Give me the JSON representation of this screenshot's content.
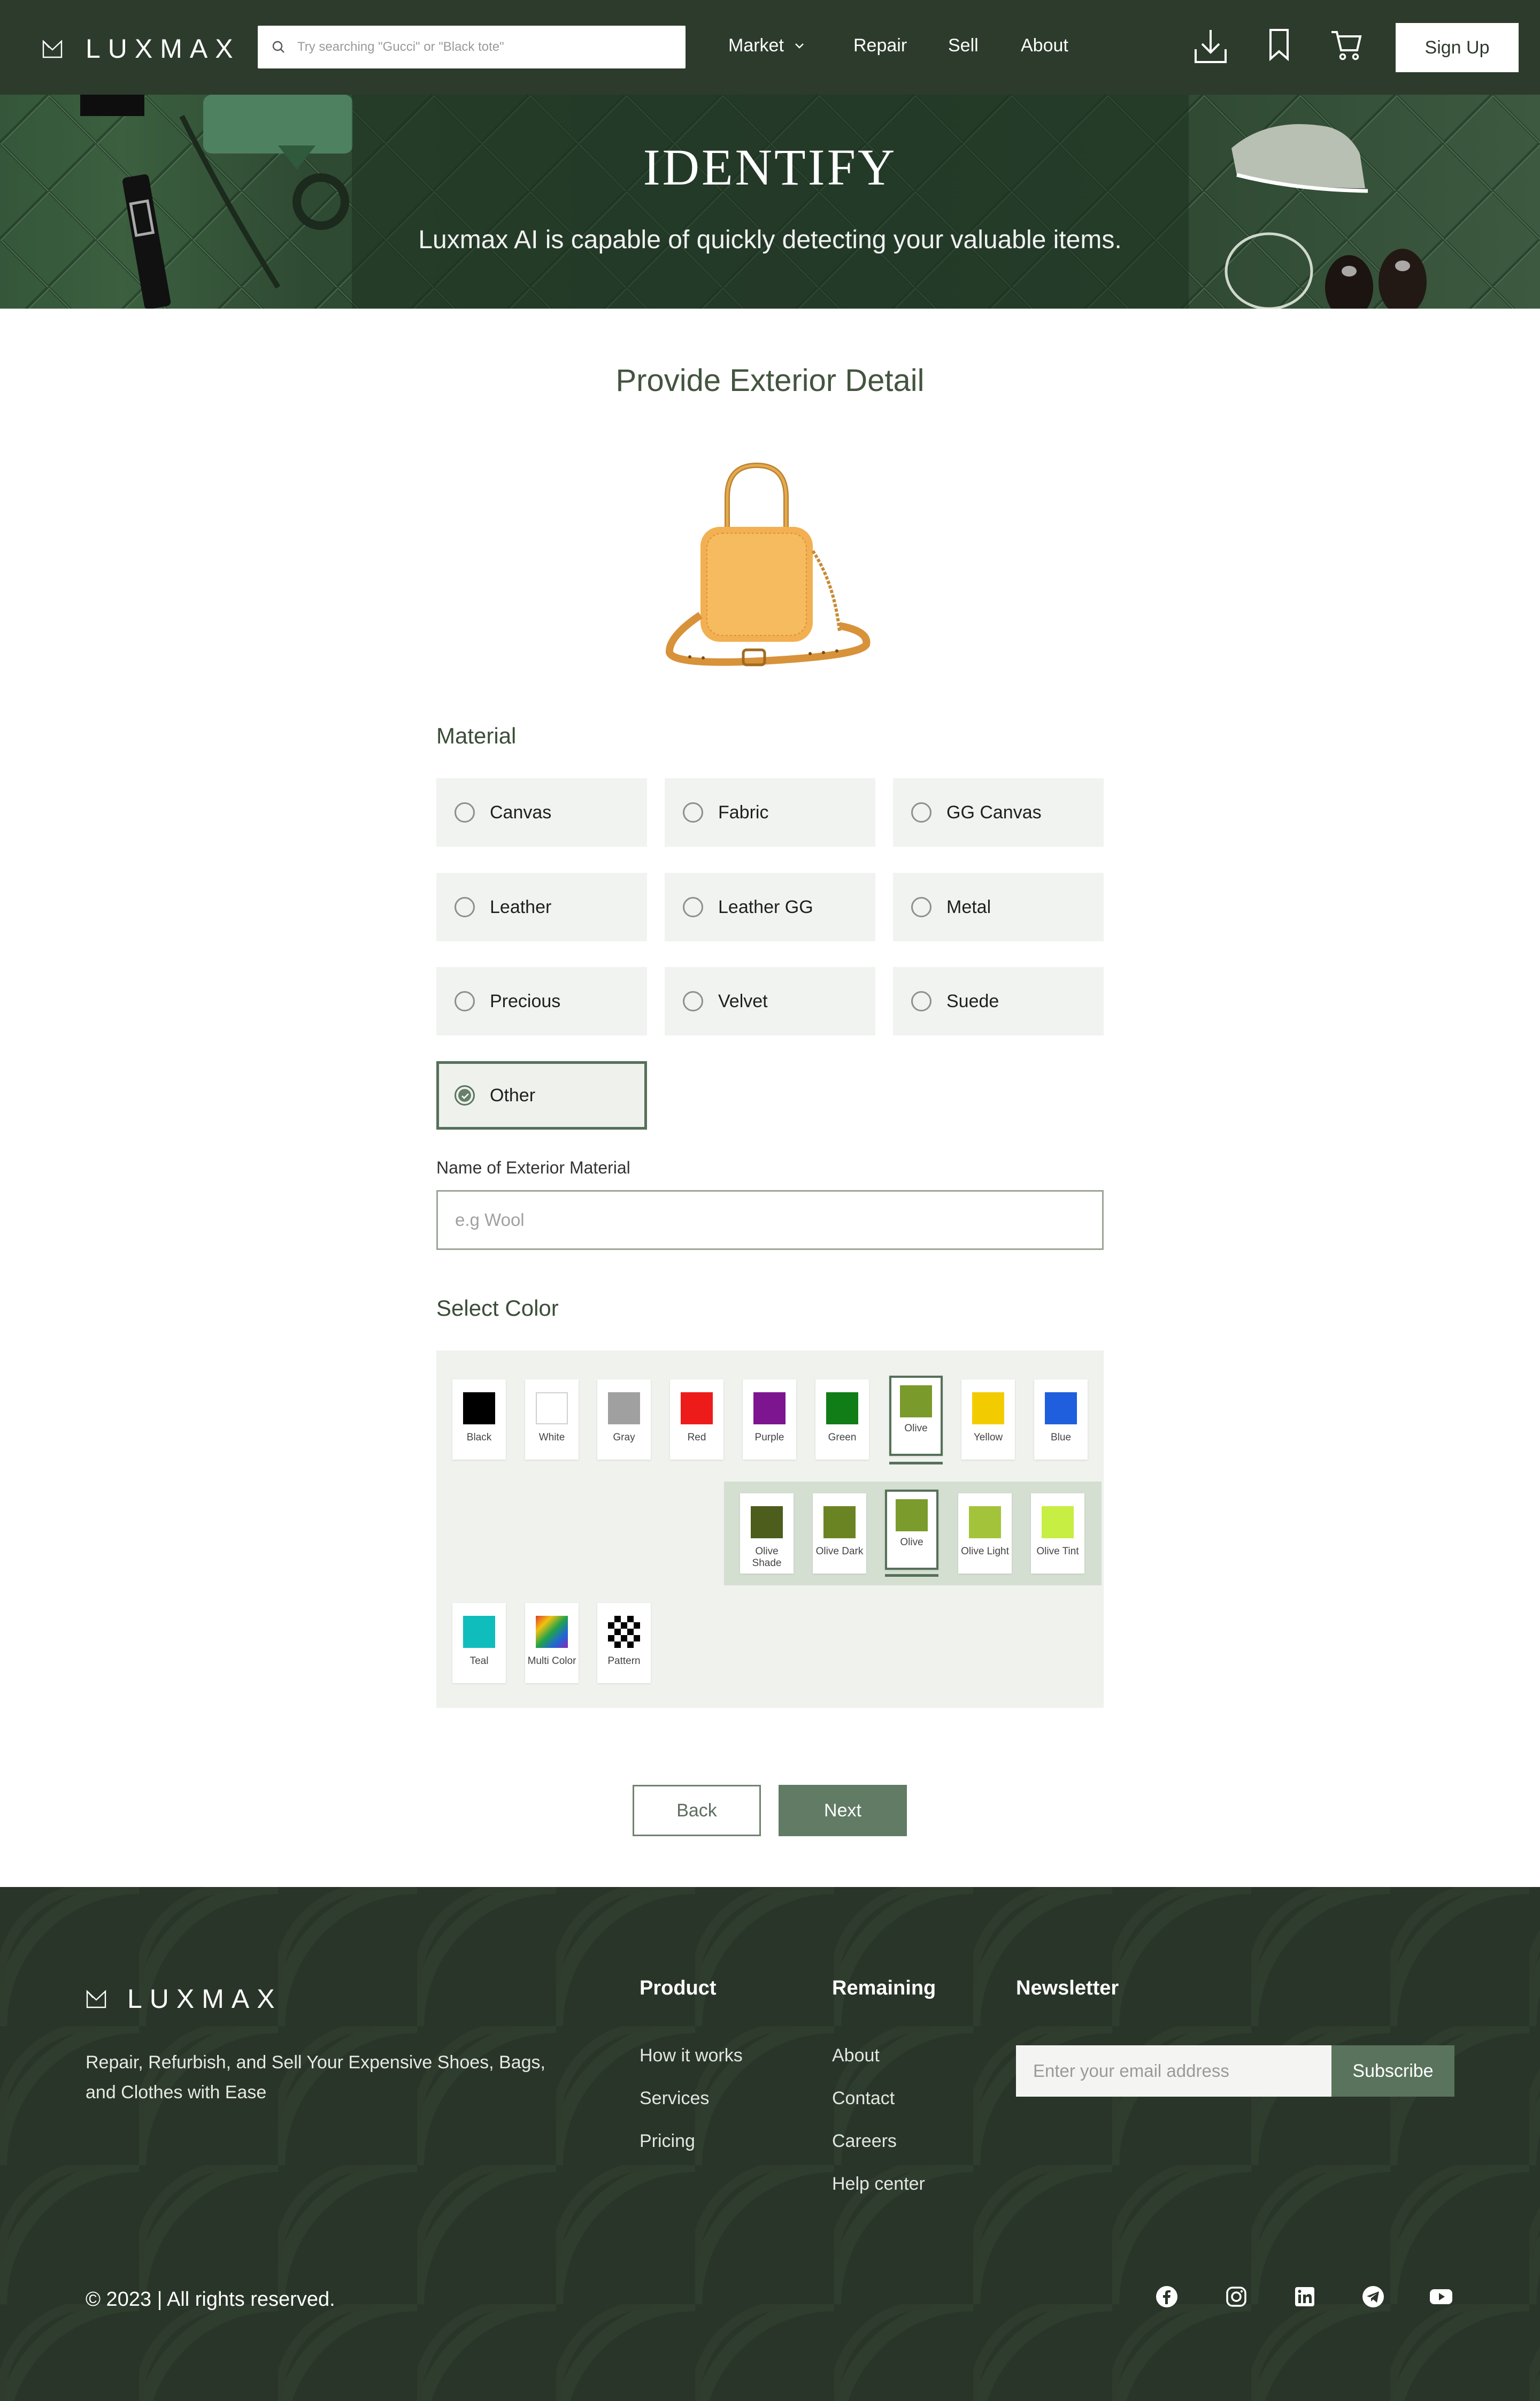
{
  "nav": {
    "brand": "LUXMAX",
    "search_placeholder": "Try searching \"Gucci\" or \"Black tote\"",
    "links": [
      "Market",
      "Repair",
      "Sell",
      "About"
    ],
    "icons": [
      "download-icon",
      "bookmark-icon",
      "cart-icon"
    ],
    "signup_label": "Sign Up"
  },
  "hero": {
    "title": "IDENTIFY",
    "subtitle": "Luxmax AI is capable of quickly detecting your valuable items."
  },
  "main": {
    "title": "Provide Exterior Detail",
    "material_label": "Material",
    "materials": [
      {
        "label": "Canvas",
        "selected": false
      },
      {
        "label": "Fabric",
        "selected": false
      },
      {
        "label": "GG Canvas",
        "selected": false
      },
      {
        "label": "Leather",
        "selected": false
      },
      {
        "label": "Leather GG",
        "selected": false
      },
      {
        "label": "Metal",
        "selected": false
      },
      {
        "label": "Precious",
        "selected": false
      },
      {
        "label": "Velvet",
        "selected": false
      },
      {
        "label": "Suede",
        "selected": false
      },
      {
        "label": "Other",
        "selected": true
      }
    ],
    "exterior_name_label": "Name of Exterior Material",
    "exterior_name_placeholder": "e.g Wool",
    "exterior_name_value": "",
    "color_label": "Select Color",
    "colors": [
      {
        "label": "Black",
        "hex": "#000000"
      },
      {
        "label": "White",
        "hex": "#ffffff"
      },
      {
        "label": "Gray",
        "hex": "#a0a0a0"
      },
      {
        "label": "Red",
        "hex": "#ee1b1b"
      },
      {
        "label": "Purple",
        "hex": "#7d1590"
      },
      {
        "label": "Green",
        "hex": "#117d17"
      },
      {
        "label": "Olive",
        "hex": "#7a9a2b",
        "selected": true
      },
      {
        "label": "Yellow",
        "hex": "#f2cc00"
      },
      {
        "label": "Blue",
        "hex": "#1f5fdd"
      }
    ],
    "olive_shades": [
      {
        "label": "Olive Shade",
        "hex": "#4c5d1c"
      },
      {
        "label": "Olive Dark",
        "hex": "#6b8423"
      },
      {
        "label": "Olive",
        "hex": "#7b9b2c",
        "selected": true
      },
      {
        "label": "Olive Light",
        "hex": "#a3c43a"
      },
      {
        "label": "Olive Tint",
        "hex": "#c6ee43"
      }
    ],
    "more_colors": [
      {
        "label": "Teal",
        "hex": "#10bdbd"
      },
      {
        "label": "Multi Color",
        "hex": "multi"
      },
      {
        "label": "Pattern",
        "hex": "pattern"
      }
    ],
    "back_label": "Back",
    "next_label": "Next"
  },
  "footer": {
    "brand": "LUXMAX",
    "tagline": "Repair, Refurbish, and Sell Your Expensive Shoes, Bags, and Clothes with Ease",
    "product_heading": "Product",
    "product_links": [
      "How it works",
      "Services",
      "Pricing"
    ],
    "remaining_heading": "Remaining",
    "remaining_links": [
      "About",
      "Contact",
      "Careers",
      "Help center"
    ],
    "newsletter_heading": "Newsletter",
    "newsletter_placeholder": "Enter your email address",
    "subscribe_label": "Subscribe",
    "copyright": "© 2023 |  All rights reserved.",
    "social": [
      "facebook-icon",
      "instagram-icon",
      "linkedin-icon",
      "telegram-icon",
      "youtube-icon"
    ]
  }
}
